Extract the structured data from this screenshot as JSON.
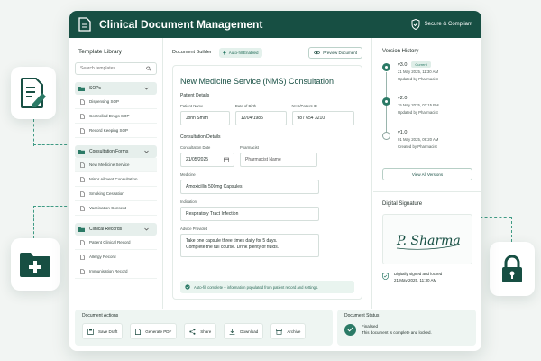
{
  "app": {
    "title": "Clinical Document Management",
    "secure_label": "Secure & Compliant",
    "accent": "#174f43"
  },
  "sidebar": {
    "title": "Template Library",
    "search_placeholder": "Search templates...",
    "groups": [
      {
        "label": "SOPs",
        "icon": "folder-icon",
        "items": [
          "Dispensing SOP",
          "Controlled Drugs SOP",
          "Record Keeping SOP"
        ]
      },
      {
        "label": "Consultation Forms",
        "icon": "folder-icon",
        "items": [
          "New Medicine Service",
          "Minor Ailment Consultation",
          "Smoking Cessation",
          "Vaccination Consent"
        ]
      },
      {
        "label": "Clinical Records",
        "icon": "folder-icon",
        "items": [
          "Patient Clinical Record",
          "Allergy Record",
          "Immunisation Record"
        ]
      }
    ]
  },
  "builder": {
    "title": "Document Builder",
    "autofill_badge": "Auto-fill Enabled",
    "preview_button": "Preview Document",
    "doc_title": "New Medicine Service (NMS) Consultation",
    "patient_section": "Patient Details",
    "patient": {
      "name_label": "Patient Name",
      "name": "John Smith",
      "dob_label": "Date of Birth",
      "dob": "12/04/1985",
      "id_label": "NHS/Patient ID",
      "id": "987 654 3210"
    },
    "consult_section": "Consultation Details",
    "consult": {
      "date_label": "Consultation Date",
      "date": "21/05/2025",
      "pharm_label": "Pharmacist",
      "pharm_placeholder": "Pharmacist Name",
      "med_label": "Medicine",
      "med": "Amoxicillin 500mg Capsules",
      "ind_label": "Indication",
      "ind": "Respiratory Tract Infection",
      "advice_label": "Advice Provided",
      "advice_line1": "Take one capsule three times daily for 5 days.",
      "advice_line2": "Complete the full course. Drink plenty of fluids."
    },
    "notice": "Auto-fill complete – information populated from patient record and settings."
  },
  "versions": {
    "title": "Version History",
    "current_badge": "Current",
    "items": [
      {
        "v": "v3.0",
        "date": "21 May 2025, 11:30 AM",
        "by": "Updated by Pharmacist",
        "current": true
      },
      {
        "v": "v2.0",
        "date": "15 May 2025, 02:15 PM",
        "by": "Updated by Pharmacist",
        "current": false
      },
      {
        "v": "v1.0",
        "date": "01 May 2025, 09:20 AM",
        "by": "Created by Pharmacist",
        "current": false
      }
    ],
    "view_all": "View All Versions"
  },
  "signature": {
    "title": "Digital Signature",
    "sig_text": "P. Sharma",
    "signed_line1": "Digitally signed and locked",
    "signed_line2": "21 May 2025, 11:30 AM"
  },
  "actions": {
    "title": "Document Actions",
    "buttons": [
      "Save Draft",
      "Generate PDF",
      "Share",
      "Download",
      "Archive"
    ]
  },
  "status": {
    "title": "Document Status",
    "state": "Finalised",
    "detail": "This document is complete and locked."
  }
}
